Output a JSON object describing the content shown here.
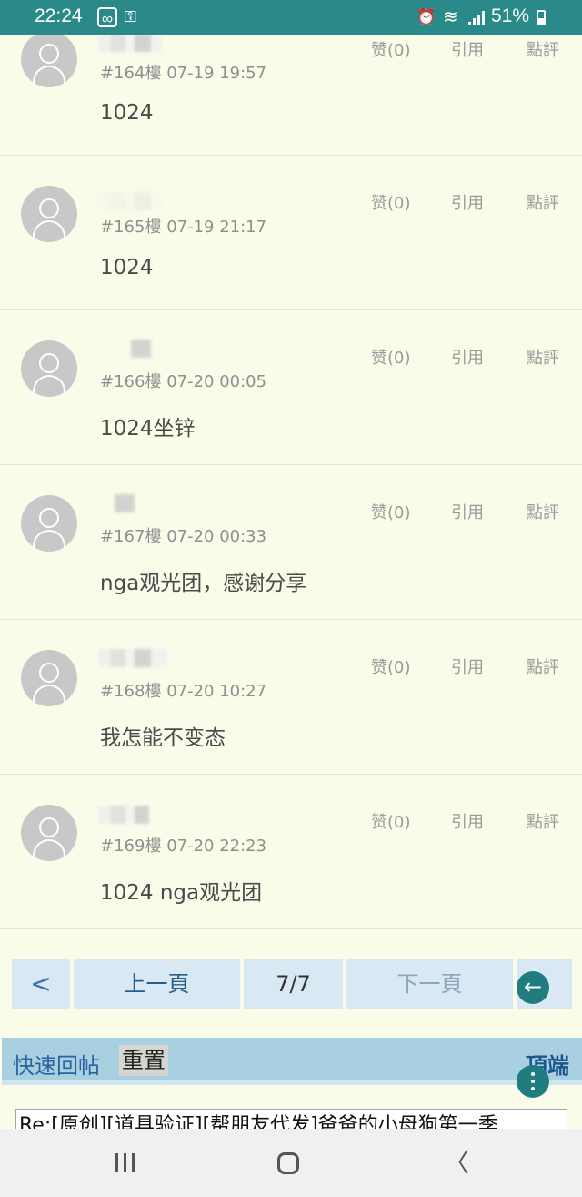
{
  "status_bar": {
    "time": "22:24",
    "battery_text": "51%",
    "icons": [
      "link-icon",
      "key-icon",
      "alarm-icon",
      "wifi-icon",
      "signal-icon",
      "battery-icon"
    ],
    "key_glyph": "⚿",
    "alarm_glyph": "⏰",
    "wifi_glyph": "≋"
  },
  "actions": {
    "like": "赞(0)",
    "quote": "引用",
    "review": "點評"
  },
  "posts": [
    {
      "floor": "#164樓",
      "time": "07-19 19:57",
      "content": "1024"
    },
    {
      "floor": "#165樓",
      "time": "07-19 21:17",
      "content": "1024"
    },
    {
      "floor": "#166樓",
      "time": "07-20 00:05",
      "content": "1024坐锌"
    },
    {
      "floor": "#167樓",
      "time": "07-20 00:33",
      "content": "nga观光团，感谢分享"
    },
    {
      "floor": "#168樓",
      "time": "07-20 10:27",
      "content": "我怎能不变态"
    },
    {
      "floor": "#169樓",
      "time": "07-20 22:23",
      "content": "1024 nga观光团"
    }
  ],
  "pagination": {
    "back": "<",
    "prev": "上一頁",
    "current": "7/7",
    "next": "下一頁",
    "fab_arrow": "←"
  },
  "quick_reply": {
    "title": "快速回帖",
    "reset": "重置",
    "top": "頂端",
    "subject_value": "Re:[原创][道具验证][帮朋友代发]爸爸的小母狗第一季"
  },
  "nav_bar": {
    "back_glyph": "〈"
  },
  "colors": {
    "status_bar": "#2a8a8a",
    "page_bg": "#fbfbea",
    "pager_bg": "#d8e9f3",
    "reply_bar_bg": "#a9d0e0",
    "fab": "#1f7d80"
  }
}
